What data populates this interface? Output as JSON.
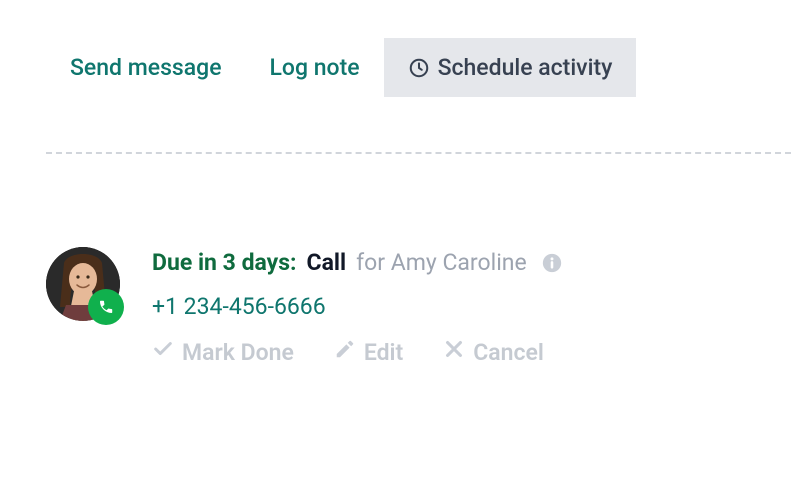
{
  "tabs": {
    "send_message": "Send message",
    "log_note": "Log note",
    "schedule_activity": "Schedule activity"
  },
  "activity": {
    "due_text": "Due in 3 days:",
    "type": "Call",
    "for_text": "for Amy Caroline",
    "phone": "+1 234-456-6666",
    "icons": {
      "badge": "phone-icon",
      "info": "info-icon"
    }
  },
  "actions": {
    "mark_done": "Mark Done",
    "edit": "Edit",
    "cancel": "Cancel"
  }
}
